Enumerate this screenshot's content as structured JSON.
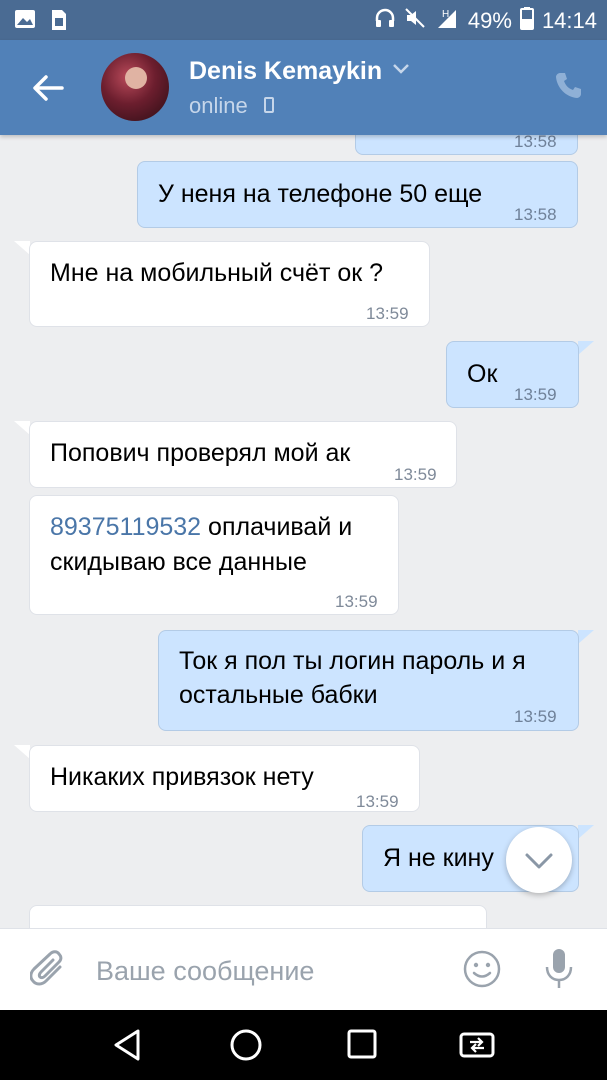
{
  "status_bar": {
    "battery_percent": "49%",
    "time": "14:14",
    "signal_label": "H"
  },
  "header": {
    "contact_name": "Denis Kemaykin",
    "status": "online"
  },
  "messages": [
    {
      "direction": "out",
      "text": "",
      "time": "13:58",
      "partial": true
    },
    {
      "direction": "out",
      "text": "У неня на телефоне 50 еще",
      "time": "13:58"
    },
    {
      "direction": "in",
      "text": "Мне на мобильный счёт ок ?",
      "time": "13:59"
    },
    {
      "direction": "out",
      "text": "Ок",
      "time": "13:59"
    },
    {
      "direction": "in",
      "text": "Попович проверял мой ак",
      "time": "13:59"
    },
    {
      "direction": "in",
      "link": "89375119532",
      "text_line1": "оплачивай и",
      "text_line2": "скидываю все данные",
      "time": "13:59"
    },
    {
      "direction": "out",
      "text_line1": "Ток я пол ты логин пароль и я",
      "text_line2": "остальные бабки",
      "time": "13:59"
    },
    {
      "direction": "in",
      "text": "Никаких привязок нету",
      "time": "13:59"
    },
    {
      "direction": "out",
      "text": "Я не кину",
      "time": "13:59"
    }
  ],
  "composer": {
    "placeholder": "Ваше сообщение"
  },
  "colors": {
    "header": "#5181b8",
    "status_bar": "#4a6b93",
    "outgoing_bubble": "#cce4ff",
    "incoming_bubble": "#ffffff",
    "chat_background": "#edeef0",
    "link": "#4a76a8"
  },
  "icons": [
    "image-icon",
    "sim-icon",
    "headphones-icon",
    "mute-icon",
    "signal-icon",
    "battery-icon",
    "back-arrow-icon",
    "chevron-down-icon",
    "phone-icon",
    "paperclip-icon",
    "emoji-icon",
    "microphone-icon",
    "nav-back-icon",
    "nav-home-icon",
    "nav-recents-icon",
    "screen-cast-icon"
  ]
}
